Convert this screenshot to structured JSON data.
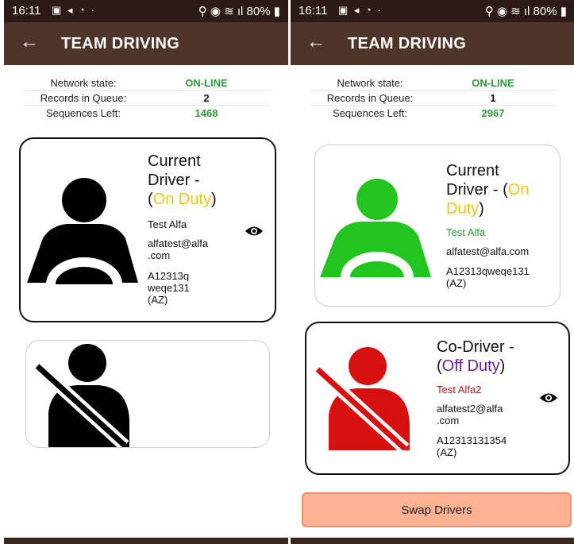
{
  "left": {
    "status_bar": {
      "time": "16:11",
      "battery": "80%"
    },
    "header": {
      "back_icon": "arrow-left-icon",
      "title": "TEAM DRIVING"
    },
    "info": {
      "network_label": "Network state:",
      "network_value": "ON-LINE",
      "queue_label": "Records in Queue:",
      "queue_value": "2",
      "sequences_label": "Sequences Left:",
      "sequences_value": "1468"
    },
    "current_driver": {
      "title_line1": "Current",
      "title_line2": "Driver -",
      "paren_open": "(",
      "status": "On Duty",
      "paren_close": ")",
      "name": "Test Alfa",
      "email_line1": "alfatest@alfa",
      "email_line2": ".com",
      "license_line1": "A12313q",
      "license_line2": "weqe131",
      "license_line3": "(AZ)",
      "icon": "steering-wheel-driver-icon",
      "icon_color": "#000000"
    },
    "co_driver": {
      "icon": "seatbelt-driver-icon",
      "icon_color": "#000000"
    }
  },
  "right": {
    "status_bar": {
      "time": "16:11",
      "battery": "80%"
    },
    "header": {
      "back_icon": "arrow-left-icon",
      "title": "TEAM DRIVING"
    },
    "info": {
      "network_label": "Network state:",
      "network_value": "ON-LINE",
      "queue_label": "Records in Queue:",
      "queue_value": "1",
      "sequences_label": "Sequences Left:",
      "sequences_value": "2967"
    },
    "current_driver": {
      "title_line1": "Current",
      "title_line2": "Driver - (",
      "status_part1": "On",
      "status_part2": "Duty",
      "paren_close": ")",
      "name": "Test Alfa",
      "email": "alfatest@alfa.com",
      "license_line1": "A12313qweqe131",
      "license_line2": "(AZ)",
      "icon": "steering-wheel-driver-icon",
      "icon_color": "#22c41e"
    },
    "co_driver": {
      "title_line1": "Co-Driver -",
      "paren_open": "(",
      "status": "Off Duty",
      "paren_close": ")",
      "name": "Test Alfa2",
      "email_line1": "alfatest2@alfa",
      "email_line2": ".com",
      "license_line1": "A12313131354",
      "license_line2": "(AZ)",
      "icon": "seatbelt-driver-icon",
      "icon_color": "#d60f0f"
    },
    "swap_button": "Swap Drivers"
  },
  "colors": {
    "status_bar": "#2b1a15",
    "app_bar": "#4e3429",
    "online_green": "#2e9a37",
    "on_duty": "#f0c419",
    "off_duty": "#6a1fa0",
    "name_green": "#2e9a37",
    "name_red": "#b31d1d",
    "swap_button": "#fdb391"
  }
}
